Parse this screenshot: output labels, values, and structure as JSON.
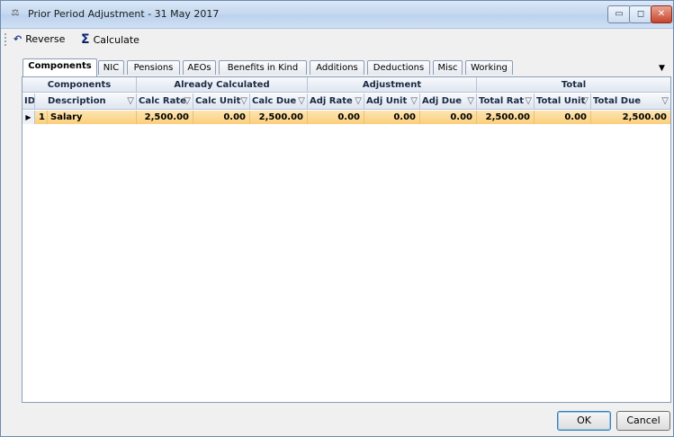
{
  "window": {
    "title": "Prior Period Adjustment - 31 May 2017",
    "minimize_label": "▭",
    "maximize_label": "◻",
    "close_label": "✕"
  },
  "toolbar": {
    "reverse_label": "Reverse",
    "calculate_label": "Calculate",
    "reverse_icon": "undo-arrow-icon",
    "calculate_icon": "sigma-icon"
  },
  "tabs": [
    {
      "label": "Components",
      "active": true
    },
    {
      "label": "NIC"
    },
    {
      "label": "Pensions"
    },
    {
      "label": "AEOs"
    },
    {
      "label": "Benefits in Kind"
    },
    {
      "label": "Additions"
    },
    {
      "label": "Deductions"
    },
    {
      "label": "Misc"
    },
    {
      "label": "Working"
    }
  ],
  "grid": {
    "bands": [
      "Components",
      "Already Calculated",
      "Adjustment",
      "Total"
    ],
    "columns": [
      "ID",
      "Description",
      "Calc Rate",
      "Calc Unit",
      "Calc Due",
      "Adj Rate",
      "Adj Unit",
      "Adj Due",
      "Total Rat",
      "Total Unit",
      "Total Due"
    ],
    "filter_glyph": "▽",
    "rows": [
      [
        "1",
        "Salary",
        "2,500.00",
        "0.00",
        "2,500.00",
        "0.00",
        "0.00",
        "0.00",
        "2,500.00",
        "0.00",
        "2,500.00"
      ]
    ],
    "row_indicator": "▶",
    "selected_row_color": "#fbcf7a"
  },
  "buttons": {
    "ok_label": "OK",
    "cancel_label": "Cancel"
  }
}
